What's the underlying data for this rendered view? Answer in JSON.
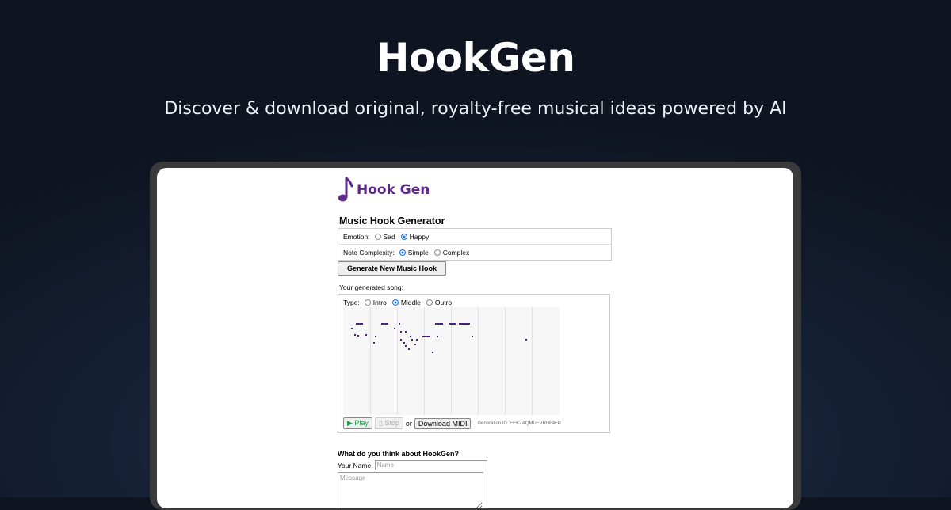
{
  "hero": {
    "title": "HookGen",
    "subtitle": "Discover & download original, royalty-free musical ideas powered by AI"
  },
  "app": {
    "brand_name": "Hook Gen",
    "brand_color": "#5b2a86",
    "title": "Music Hook Generator",
    "emotion": {
      "label": "Emotion:",
      "options": [
        "Sad",
        "Happy"
      ],
      "selected": "Happy"
    },
    "complexity": {
      "label": "Note Complexity:",
      "options": [
        "Simple",
        "Complex"
      ],
      "selected": "Simple"
    },
    "generate_label": "Generate New Music Hook",
    "song_label": "Your generated song:",
    "type": {
      "label": "Type:",
      "options": [
        "Intro",
        "Middle",
        "Outro"
      ],
      "selected": "Middle"
    },
    "play_label": "▶ Play",
    "stop_label": "▯ Stop",
    "or_text": "or",
    "download_label": "Download MIDI",
    "generation_id": "Generation ID: EEKZAQMUFVRDF4FP",
    "note_color": "#4a1f7a"
  },
  "feedback": {
    "title": "What do you think about HookGen?",
    "name_label": "Your Name:",
    "name_placeholder": "Name",
    "message_placeholder": "Message"
  }
}
